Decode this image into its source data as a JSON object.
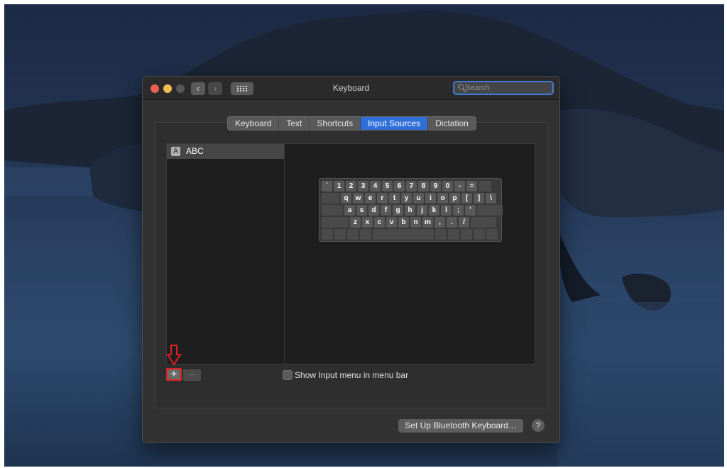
{
  "window": {
    "title": "Keyboard",
    "search_placeholder": "Search",
    "search_icon": "magnifier-icon",
    "nav_back_icon": "chevron-left-icon",
    "nav_forward_icon": "chevron-right-icon",
    "grid_icon": "show-all-grid-icon"
  },
  "tabs": [
    {
      "label": "Keyboard",
      "active": false
    },
    {
      "label": "Text",
      "active": false
    },
    {
      "label": "Shortcuts",
      "active": false
    },
    {
      "label": "Input Sources",
      "active": true
    },
    {
      "label": "Dictation",
      "active": false
    }
  ],
  "input_sources": [
    {
      "badge": "A",
      "label": "ABC",
      "selected": true
    }
  ],
  "keyboard_rows": [
    [
      "`",
      "1",
      "2",
      "3",
      "4",
      "5",
      "6",
      "7",
      "8",
      "9",
      "0",
      "-",
      "="
    ],
    [
      "q",
      "w",
      "e",
      "r",
      "t",
      "y",
      "u",
      "i",
      "o",
      "p",
      "[",
      "]",
      "\\"
    ],
    [
      "a",
      "s",
      "d",
      "f",
      "g",
      "h",
      "j",
      "k",
      "l",
      ";",
      "'"
    ],
    [
      "z",
      "x",
      "c",
      "v",
      "b",
      "n",
      "m",
      ",",
      ".",
      "/"
    ]
  ],
  "list_controls": {
    "add_label": "+",
    "remove_label": "−"
  },
  "show_input_menu": {
    "label": "Show Input menu in menu bar",
    "checked": false
  },
  "footer": {
    "bluetooth_button": "Set Up Bluetooth Keyboard…",
    "help_label": "?"
  },
  "colors": {
    "accent": "#2f6fd9",
    "annotation_red": "#e02020"
  }
}
